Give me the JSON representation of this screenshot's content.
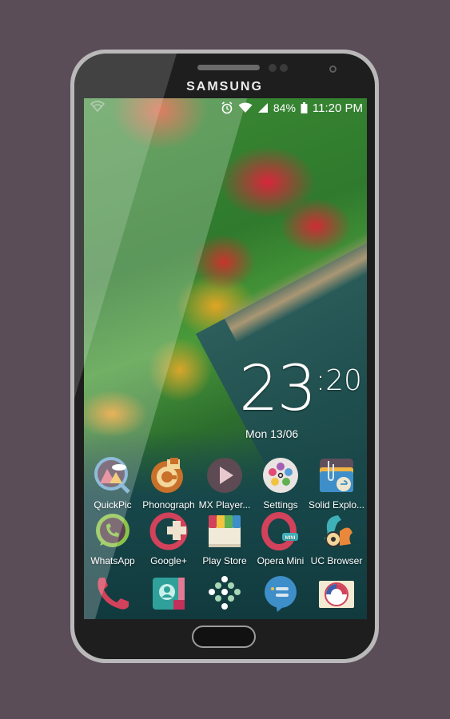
{
  "device": {
    "brand": "SAMSUNG"
  },
  "status_bar": {
    "icons": [
      "wifi-icon",
      "alarm-icon",
      "wifi-icon",
      "signal-icon",
      "battery-icon"
    ],
    "battery": "84%",
    "time": "11:20 PM"
  },
  "clock_widget": {
    "hour": "23",
    "minute": ":20",
    "date": "Mon  13/06"
  },
  "apps": [
    {
      "label": "QuickPic",
      "icon": "quickpic-icon"
    },
    {
      "label": "Phonograph",
      "icon": "phonograph-icon"
    },
    {
      "label": "MX Player...",
      "icon": "mx-player-icon"
    },
    {
      "label": "Settings",
      "icon": "settings-icon"
    },
    {
      "label": "Solid Explo...",
      "icon": "solid-explorer-icon"
    },
    {
      "label": "WhatsApp",
      "icon": "whatsapp-icon"
    },
    {
      "label": "Google+",
      "icon": "google-plus-icon"
    },
    {
      "label": "Play Store",
      "icon": "play-store-icon"
    },
    {
      "label": "Opera Mini",
      "icon": "opera-mini-icon"
    },
    {
      "label": "UC Browser",
      "icon": "uc-browser-icon"
    }
  ],
  "dock": [
    {
      "icon": "phone-icon"
    },
    {
      "icon": "contacts-icon"
    },
    {
      "icon": "fitbit-icon"
    },
    {
      "icon": "messages-icon"
    },
    {
      "icon": "camera-icon"
    }
  ],
  "colors": {
    "background": "#5b4d57",
    "frame": "#b9b9b9",
    "bezel": "#1e1e1e"
  }
}
